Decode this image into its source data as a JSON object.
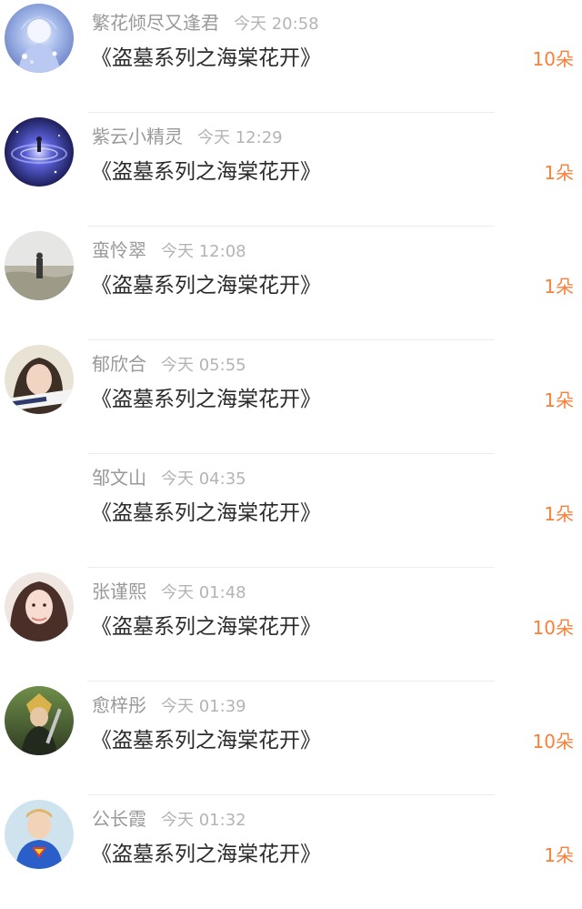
{
  "colors": {
    "username": "#999999",
    "time": "#b4b4b4",
    "title": "#2b2b2b",
    "count": "#f5813b",
    "divider": "#ececec"
  },
  "items": [
    {
      "username": "繁花倾尽又逢君",
      "time": "今天 20:58",
      "title": "《盗墓系列之海棠花开》",
      "count": "10朵",
      "avatar": "anime-character-avatar"
    },
    {
      "username": "紫云小精灵",
      "time": "今天 12:29",
      "title": "《盗墓系列之海棠花开》",
      "count": "1朵",
      "avatar": "galaxy-avatar"
    },
    {
      "username": "蛮怜翠",
      "time": "今天 12:08",
      "title": "《盗墓系列之海棠花开》",
      "count": "1朵",
      "avatar": "foggy-field-person-avatar"
    },
    {
      "username": "郁欣合",
      "time": "今天 05:55",
      "title": "《盗墓系列之海棠花开》",
      "count": "1朵",
      "avatar": "girl-portrait-avatar"
    },
    {
      "username": "邹文山",
      "time": "今天 04:35",
      "title": "《盗墓系列之海棠花开》",
      "count": "1朵",
      "avatar": ""
    },
    {
      "username": "张谨熙",
      "time": "今天 01:48",
      "title": "《盗墓系列之海棠花开》",
      "count": "10朵",
      "avatar": "woman-portrait-avatar"
    },
    {
      "username": "愈梓彤",
      "time": "今天 01:39",
      "title": "《盗墓系列之海棠花开》",
      "count": "10朵",
      "avatar": "game-character-avatar"
    },
    {
      "username": "公长霞",
      "time": "今天 01:32",
      "title": "《盗墓系列之海棠花开》",
      "count": "1朵",
      "avatar": "child-superman-shirt-avatar"
    }
  ]
}
